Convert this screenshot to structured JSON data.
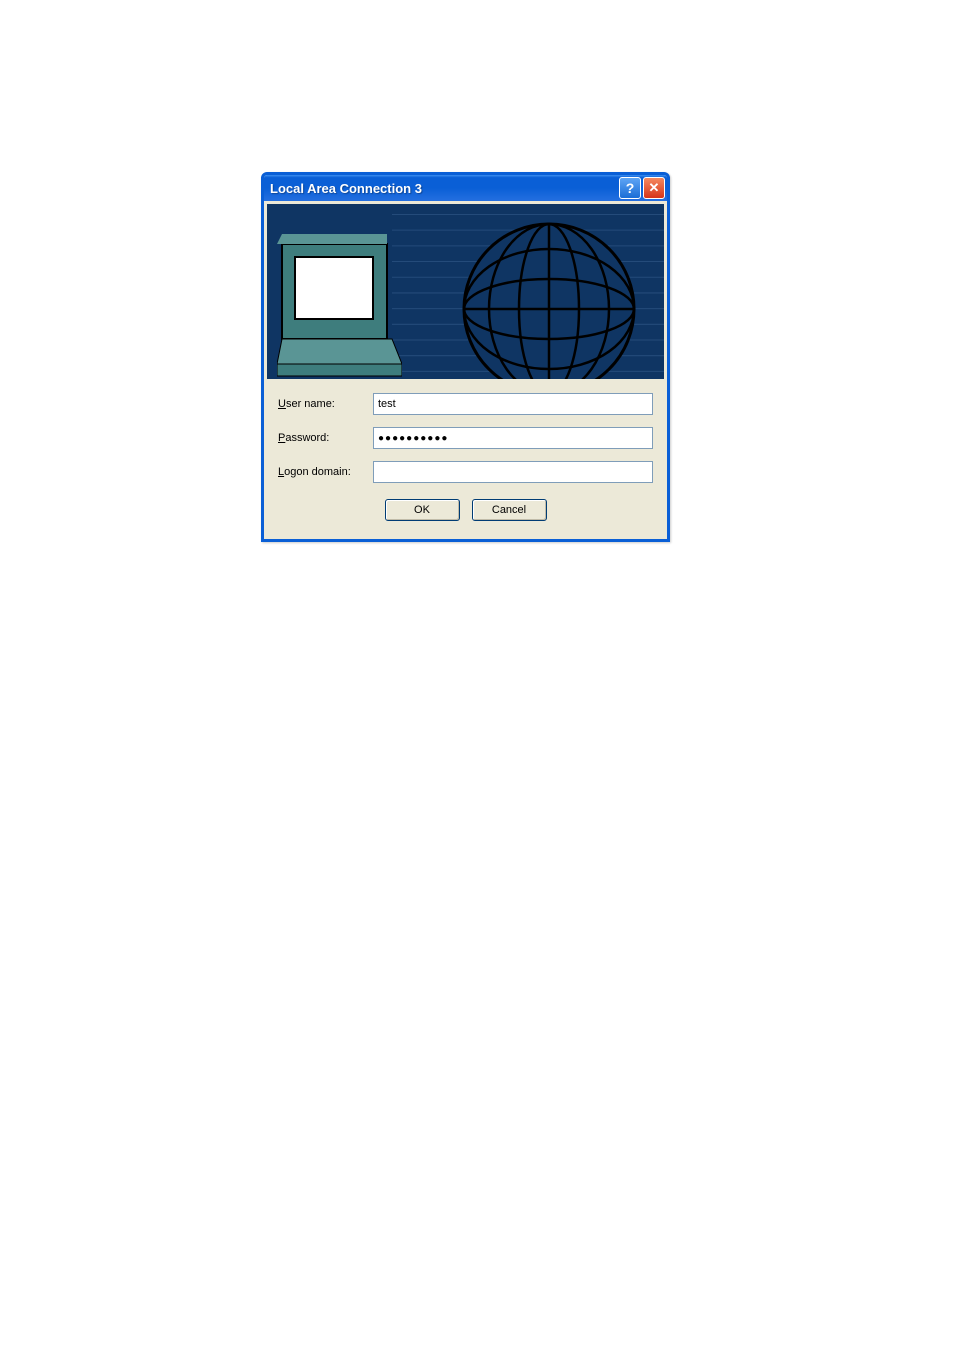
{
  "dialog": {
    "title": "Local Area Connection 3",
    "help_symbol": "?",
    "close_symbol": "✕",
    "fields": {
      "username": {
        "label_pre": "U",
        "label_post": "ser name:",
        "value": "test"
      },
      "password": {
        "label_pre": "P",
        "label_post": "assword:",
        "value": "●●●●●●●●●●"
      },
      "logon_domain": {
        "label_pre": "L",
        "label_post": "ogon domain:",
        "value": ""
      }
    },
    "buttons": {
      "ok": "OK",
      "cancel": "Cancel"
    }
  }
}
